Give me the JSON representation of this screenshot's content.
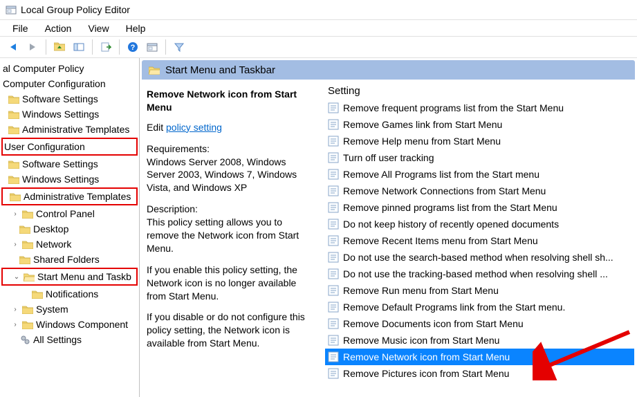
{
  "window": {
    "title": "Local Group Policy Editor"
  },
  "menubar": [
    "File",
    "Action",
    "View",
    "Help"
  ],
  "tree": {
    "root1": "al Computer Policy",
    "compConfig": "Computer Configuration",
    "compChildren": [
      "Software Settings",
      "Windows Settings",
      "Administrative Templates"
    ],
    "userConfig": "User Configuration",
    "userChildren": [
      "Software Settings",
      "Windows Settings"
    ],
    "adminTemplates": "Administrative Templates",
    "adminChildren": [
      "Control Panel",
      "Desktop",
      "Network",
      "Shared Folders"
    ],
    "startMenu": "Start Menu and Taskb",
    "notifications": "Notifications",
    "tailChildren": [
      "System",
      "Windows Component"
    ],
    "allSettings": "All Settings"
  },
  "tab": {
    "title": "Start Menu and Taskbar"
  },
  "description": {
    "policyName": "Remove Network icon from Start Menu",
    "editPrefix": "Edit ",
    "editLink": "policy setting",
    "reqLabel": "Requirements:",
    "reqText": "Windows Server 2008, Windows Server 2003, Windows 7, Windows Vista, and Windows XP",
    "descLabel": "Description:",
    "descText": "This policy setting allows you to remove the Network icon from Start Menu.",
    "para2": "If you enable this policy setting, the Network icon is no longer available from Start Menu.",
    "para3": "If you disable or do not configure this policy setting, the Network icon is available from Start Menu."
  },
  "list": {
    "header": "Setting",
    "items": [
      "Remove frequent programs list from the Start Menu",
      "Remove Games link from Start Menu",
      "Remove Help menu from Start Menu",
      "Turn off user tracking",
      "Remove All Programs list from the Start menu",
      "Remove Network Connections from Start Menu",
      "Remove pinned programs list from the Start Menu",
      "Do not keep history of recently opened documents",
      "Remove Recent Items menu from Start Menu",
      "Do not use the search-based method when resolving shell sh...",
      "Do not use the tracking-based method when resolving shell ...",
      "Remove Run menu from Start Menu",
      "Remove Default Programs link from the Start menu.",
      "Remove Documents icon from Start Menu",
      "Remove Music icon from Start Menu",
      "Remove Network icon from Start Menu",
      "Remove Pictures icon from Start Menu"
    ],
    "selectedIndex": 15
  }
}
